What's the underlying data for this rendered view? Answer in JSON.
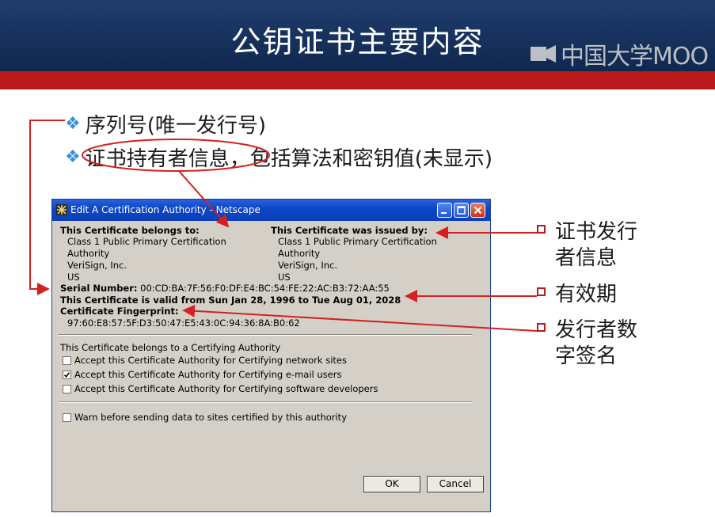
{
  "slide": {
    "title": "公钥证书主要内容",
    "logo_text": "中国大学MOO"
  },
  "bullets": [
    {
      "text": "序列号(唯一发行号)"
    },
    {
      "text": "证书持有者信息，包括算法和密钥值(未显示)"
    }
  ],
  "dialog": {
    "title": "Edit A Certification Authority - Netscape",
    "belongs_to": {
      "heading": "This Certificate belongs to:",
      "line1": "Class 1 Public Primary Certification",
      "line2": "Authority",
      "line3": "VeriSign, Inc.",
      "line4": "US"
    },
    "issued_by": {
      "heading": "This Certificate was issued by:",
      "line1": "Class 1 Public Primary Certification",
      "line2": "Authority",
      "line3": "VeriSign, Inc.",
      "line4": "US"
    },
    "serial_label": "Serial Number:",
    "serial_value": "00:CD:BA:7F:56:F0:DF:E4:BC:54:FE:22:AC:B3:72:AA:55",
    "validity": "This Certificate is valid from Sun Jan 28, 1996 to Tue Aug 01, 2028",
    "fingerprint_label": "Certificate Fingerprint:",
    "fingerprint_value": "97:60:E8:57:5F:D3:50:47:E5:43:0C:94:36:8A:B0:62",
    "authority_text": "This Certificate belongs to a Certifying Authority",
    "checkboxes": [
      {
        "label": "Accept this Certificate Authority for Certifying network sites",
        "checked": false
      },
      {
        "label": "Accept this Certificate Authority for Certifying e-mail users",
        "checked": true
      },
      {
        "label": "Accept this Certificate Authority for Certifying software developers",
        "checked": false
      }
    ],
    "warn_checkbox": {
      "label": "Warn before sending data to sites certified by this authority",
      "checked": false
    },
    "ok_label": "OK",
    "cancel_label": "Cancel"
  },
  "callouts": [
    {
      "line1": "证书发行",
      "line2": "者信息"
    },
    {
      "line1": "有效期",
      "line2": ""
    },
    {
      "line1": "发行者数",
      "line2": "字签名"
    }
  ],
  "colors": {
    "header_blue": "#1f3d6e",
    "band_red": "#b81a1a",
    "annotation_red": "#d42020",
    "bullet_diamond": "#3a8fd8"
  }
}
